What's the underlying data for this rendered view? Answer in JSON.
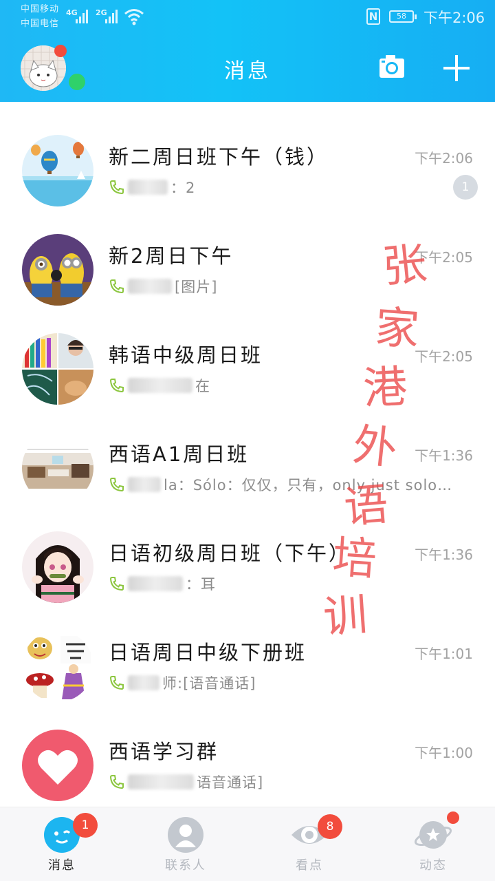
{
  "status_bar": {
    "carrier1": "中国移动",
    "carrier2": "中国电信",
    "signal1_label": "4G",
    "signal2_label": "2G",
    "nfc": "N",
    "battery": "58",
    "time": "下午2:06"
  },
  "header": {
    "title": "消息"
  },
  "chats": [
    {
      "name": "新二周日班下午（钱）",
      "time": "下午2:06",
      "preview": "：2",
      "unread": "1"
    },
    {
      "name": "新2周日下午",
      "time": "下午2:05",
      "preview": "[图片]"
    },
    {
      "name": "韩语中级周日班",
      "time": "下午2:05",
      "preview": "在"
    },
    {
      "name": "西语A1周日班",
      "time": "下午1:36",
      "preview": "la：Sólo：仅仅，只有，only just solo…"
    },
    {
      "name": "日语初级周日班（下午）",
      "time": "下午1:36",
      "preview": "：耳"
    },
    {
      "name": "日语周日中级下册班",
      "time": "下午1:01",
      "preview": "师:[语音通话]"
    },
    {
      "name": "西语学习群",
      "time": "下午1:00",
      "preview": "语音通话]"
    }
  ],
  "watermark": [
    "张",
    "家",
    "港",
    "外",
    "语",
    "培",
    "训"
  ],
  "tabs": [
    {
      "label": "消息",
      "badge": "1"
    },
    {
      "label": "联系人"
    },
    {
      "label": "看点",
      "badge": "8"
    },
    {
      "label": "动态"
    }
  ],
  "colors": {
    "header_gradient_start": "#1fb8f5",
    "header_gradient_end": "#16aef3",
    "badge_red": "#f24c3d",
    "online_green": "#2fd16a",
    "phone_green": "#8cc63f",
    "tab_active_blue": "#1cb5f0"
  },
  "icons": {
    "camera": "camera-icon",
    "plus": "plus-icon",
    "phone": "phone-icon",
    "tab_messages": "chat-bubble-icon",
    "tab_contacts": "person-icon",
    "tab_discover": "eye-icon",
    "tab_moments": "planet-star-icon"
  }
}
